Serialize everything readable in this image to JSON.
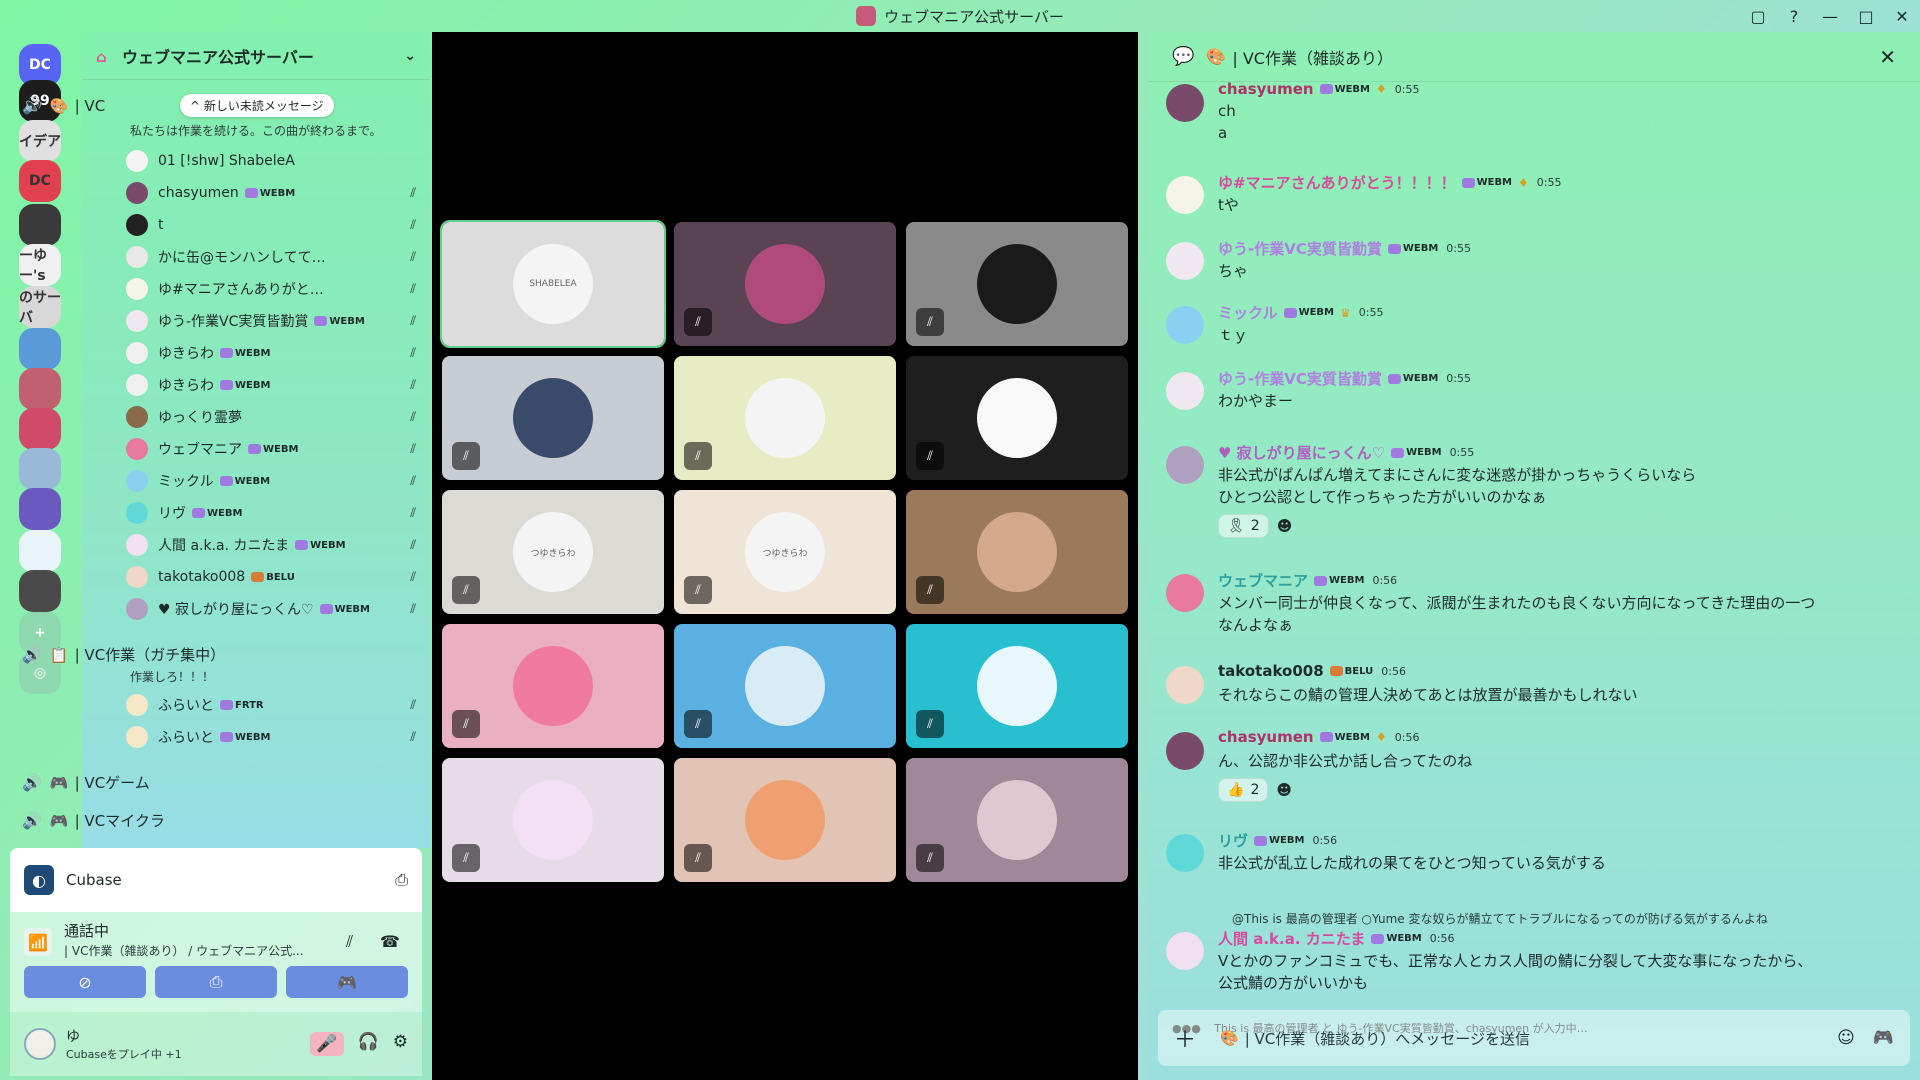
{
  "window": {
    "title": "ウェブマニア公式サーバー",
    "controls": [
      "▢",
      "?",
      "—",
      "□",
      "✕"
    ]
  },
  "rail": {
    "servers": [
      {
        "label": "DC",
        "color": "#5865f2"
      },
      {
        "label": "99",
        "color": "#1d1d1d"
      },
      {
        "label": "イデア",
        "color": "#e0e0e0"
      },
      {
        "label": "DC",
        "color": "#e04050"
      },
      {
        "label": "",
        "color": "#3a3a3a"
      },
      {
        "label": "ーゆー's",
        "color": "#f0f0f0"
      },
      {
        "label": "のサーバ",
        "color": "#d8d8d8"
      },
      {
        "label": "",
        "color": "#5a9ad8"
      },
      {
        "label": "",
        "color": "#c06070"
      },
      {
        "label": "",
        "color": "#d04a6a"
      },
      {
        "label": "",
        "color": "#9ab8d8"
      },
      {
        "label": "",
        "color": "#6a5ac0"
      },
      {
        "label": "",
        "color": "#e8f4f8"
      },
      {
        "label": "",
        "color": "#4a4a4a"
      },
      {
        "label": "+",
        "color": "#8fd8b0"
      },
      {
        "label": "◎",
        "color": "#8fd8b0"
      }
    ]
  },
  "sidebar": {
    "server_name": "ウェブマニア公式サーバー",
    "unread_pill": "^ 新しい未読メッセージ",
    "vc1": {
      "name": "| VC",
      "status": "私たちは作業を続ける。この曲が終わるまで。"
    },
    "members1": [
      {
        "name": "01 [!shw] ShabeleA",
        "tag": "",
        "tag_type": "",
        "color": "#f4f4f4"
      },
      {
        "name": "chasyumen",
        "tag": "WEBM",
        "tag_type": "webm",
        "color": "#7a4a6a"
      },
      {
        "name": "t",
        "tag": "",
        "tag_type": "",
        "color": "#222"
      },
      {
        "name": "かに缶@モンハンしてて低浮上気味",
        "tag": "",
        "tag_type": "",
        "color": "#e8e8e8"
      },
      {
        "name": "ゆ#マニアさんありがとう！！！！",
        "tag": "",
        "tag_type": "",
        "color": "#f4f4e8"
      },
      {
        "name": "ゆう-作業VC実質皆勤賞",
        "tag": "WEBM",
        "tag_type": "webm",
        "color": "#f0e8f0"
      },
      {
        "name": "ゆきらわ",
        "tag": "WEBM",
        "tag_type": "webm",
        "color": "#f0f0f0"
      },
      {
        "name": "ゆきらわ",
        "tag": "WEBM",
        "tag_type": "webm",
        "color": "#f0f0f0"
      },
      {
        "name": "ゆっくり霊夢",
        "tag": "",
        "tag_type": "",
        "color": "#8a6a4a"
      },
      {
        "name": "ウェブマニア",
        "tag": "WEBM",
        "tag_type": "webm",
        "color": "#e87aa0"
      },
      {
        "name": "ミックル",
        "tag": "WEBM",
        "tag_type": "webm",
        "color": "#8ad0f0"
      },
      {
        "name": "リヴ",
        "tag": "WEBM",
        "tag_type": "webm",
        "color": "#60d8d8"
      },
      {
        "name": "人間 a.k.a. カニたま",
        "tag": "WEBM",
        "tag_type": "webm",
        "color": "#f0e0f0"
      },
      {
        "name": "takotako008",
        "tag": "BELU",
        "tag_type": "belu",
        "color": "#f0d8c8"
      },
      {
        "name": "♥ 寂しがり屋にっくん♡",
        "tag": "WEBM",
        "tag_type": "webm",
        "color": "#b0a0c0"
      }
    ],
    "vc2": {
      "name": "| VC作業（ガチ集中）",
      "status": "作業しろ！！！"
    },
    "members2": [
      {
        "name": "ふらいと",
        "tag": "FRTR",
        "tag_type": "frtr",
        "color": "#f4e8c8"
      },
      {
        "name": "ふらいと",
        "tag": "WEBM",
        "tag_type": "webm",
        "color": "#f4e8c8"
      }
    ],
    "vc3": {
      "name": "| VCゲーム"
    },
    "vc4": {
      "name": "| VCマイクラ"
    }
  },
  "activity": {
    "app": "Cubase"
  },
  "call": {
    "title": "通話中",
    "subtitle": "| VC作業（雑談あり） / ウェブマニア公式...",
    "buttons": [
      "⊘",
      "⎙",
      "🎮"
    ]
  },
  "user": {
    "name": "ゆ",
    "status": "Cubaseをプレイ中 +1"
  },
  "stage": {
    "tiles": [
      {
        "bg": "#dcdcdc",
        "face": "#f4f4f4",
        "label": "SHABELEA",
        "muted": false,
        "speaking": true
      },
      {
        "bg": "#5a4454",
        "face": "#b04a7a",
        "label": "",
        "muted": true,
        "speaking": false
      },
      {
        "bg": "#8a8a8a",
        "face": "#1a1a1a",
        "label": "",
        "muted": true,
        "speaking": false
      },
      {
        "bg": "#c8ccd4",
        "face": "#3a4a6a",
        "label": "",
        "muted": true,
        "speaking": false
      },
      {
        "bg": "#e8ecc4",
        "face": "#f4f4f4",
        "label": "",
        "muted": true,
        "speaking": false
      },
      {
        "bg": "#1e1e1e",
        "face": "#f8f8f8",
        "label": "",
        "muted": true,
        "speaking": false
      },
      {
        "bg": "#dcdad4",
        "face": "#f4f4f4",
        "label": "つゆきらわ",
        "muted": true,
        "speaking": false
      },
      {
        "bg": "#efe4d6",
        "face": "#f4f4f4",
        "label": "つゆきらわ",
        "muted": true,
        "speaking": false
      },
      {
        "bg": "#9a7a5a",
        "face": "#d4a88a",
        "label": "",
        "muted": true,
        "speaking": false
      },
      {
        "bg": "#eab0c0",
        "face": "#f07aa0",
        "label": "",
        "muted": true,
        "speaking": false
      },
      {
        "bg": "#5ab0e0",
        "face": "#d8ecf8",
        "label": "",
        "muted": true,
        "speaking": false
      },
      {
        "bg": "#28c0d0",
        "face": "#e8f8fa",
        "label": "",
        "muted": true,
        "speaking": false
      },
      {
        "bg": "#e6dce8",
        "face": "#f4e0f4",
        "label": "",
        "muted": true,
        "speaking": false
      },
      {
        "bg": "#e2c4b4",
        "face": "#f0a070",
        "label": "",
        "muted": true,
        "speaking": false
      },
      {
        "bg": "#a0889a",
        "face": "#e0c8d0",
        "label": "",
        "muted": true,
        "speaking": false
      }
    ]
  },
  "chat": {
    "header": "| VC作業（雑談あり）",
    "messages": [
      {
        "author": "chasyumen",
        "color": "#b0306a",
        "tag": "WEBM",
        "badge": "♦",
        "time": "0:55",
        "lines": [
          "ch",
          "a"
        ],
        "avatar": "#7a4a6a"
      },
      {
        "author": "ゆ#マニアさんありがとう！！！！",
        "color": "#d84aa0",
        "tag": "WEBM",
        "badge": "♦",
        "time": "0:55",
        "lines": [
          "tや"
        ],
        "avatar": "#f4f4e8"
      },
      {
        "author": "ゆう-作業VC実質皆勤賞",
        "color": "#b080e0",
        "tag": "WEBM",
        "badge": "",
        "time": "0:55",
        "lines": [
          "ちゃ"
        ],
        "avatar": "#f0e8f0"
      },
      {
        "author": "ミックル",
        "color": "#b080e0",
        "tag": "WEBM",
        "badge": "♛",
        "time": "0:55",
        "lines": [
          "ｔｙ"
        ],
        "avatar": "#8ad0f0"
      },
      {
        "author": "ゆう-作業VC実質皆勤賞",
        "color": "#b080e0",
        "tag": "WEBM",
        "badge": "",
        "time": "0:55",
        "lines": [
          "わかやまー"
        ],
        "avatar": "#f0e8f0"
      },
      {
        "author": "♥ 寂しがり屋にっくん♡",
        "color": "#b060c0",
        "tag": "WEBM",
        "badge": "",
        "time": "0:55",
        "lines": [
          "非公式がぱんぱん増えてまにさんに変な迷惑が掛かっちゃうくらいなら",
          "ひとつ公認として作っちゃった方がいいのかなぁ"
        ],
        "avatar": "#b0a0c0",
        "reaction": {
          "emoji": "🎗",
          "count": "2"
        }
      },
      {
        "author": "ウェブマニア",
        "color": "#2aa0a0",
        "tag": "WEBM",
        "badge": "",
        "time": "0:56",
        "lines": [
          "メンバー同士が仲良くなって、派閥が生まれたのも良くない方向になってきた理由の一つ",
          "なんよなぁ"
        ],
        "avatar": "#e87aa0"
      },
      {
        "author": "takotako008",
        "color": "#1d2a2a",
        "tag": "BELU",
        "badge": "",
        "time": "0:56",
        "lines": [
          "それならこの鯖の管理人決めてあとは放置が最善かもしれない"
        ],
        "avatar": "#f0d8c8"
      },
      {
        "author": "chasyumen",
        "color": "#b0306a",
        "tag": "WEBM",
        "badge": "♦",
        "time": "0:56",
        "lines": [
          "ん、公認か非公式か話し合ってたのね"
        ],
        "avatar": "#7a4a6a",
        "reaction": {
          "emoji": "👍",
          "count": "2"
        }
      },
      {
        "author": "リヴ",
        "color": "#2aa0a0",
        "tag": "WEBM",
        "badge": "",
        "time": "0:56",
        "lines": [
          "非公式が乱立した成れの果てをひとつ知っている気がする"
        ],
        "avatar": "#60d8d8"
      },
      {
        "author": "人間 a.k.a. カニたま",
        "color": "#d84aa0",
        "tag": "WEBM",
        "badge": "",
        "time": "0:56",
        "lines": [
          "Vとかのファンコミュでも、正常な人とカス人間の鯖に分裂して大変な事になったから、",
          "公式鯖の方がいいかも"
        ],
        "avatar": "#f0e0f0",
        "reply": "@This is 最高の管理者 ○Yume  変な奴らが鯖立ててトラブルになるってのが防げる気がするんよね"
      }
    ],
    "typing": "This is 最高の管理者 と ゆう-作業VC実質皆勤賞、chasyumen が入力中…",
    "composer_placeholder": "| VC作業（雑談あり）へメッセージを送信"
  }
}
